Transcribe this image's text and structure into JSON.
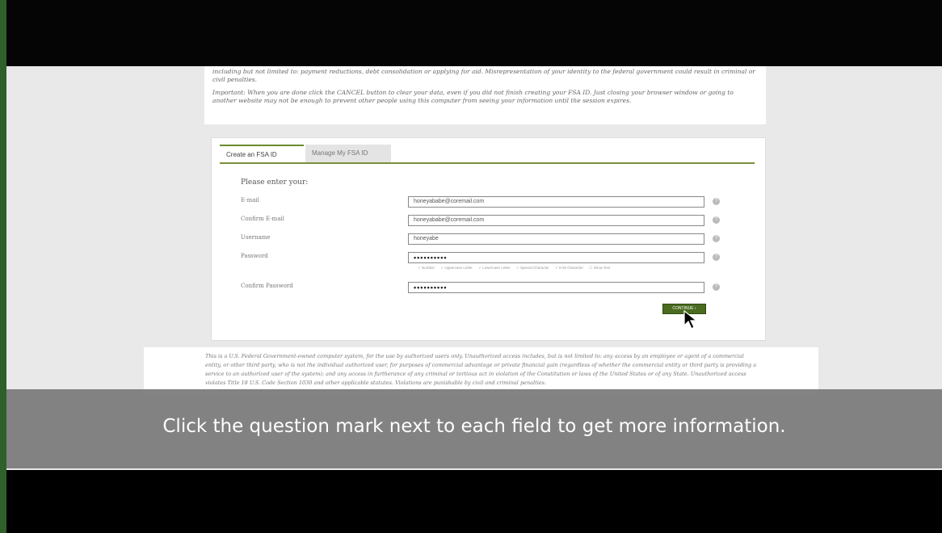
{
  "intro": {
    "paragraph1": "including but not limited to: payment reductions, debt consolidation or applying for aid. Misrepresentation of your identity to the federal government could result in criminal or civil penalties.",
    "paragraph2": "Important: When you are done click the CANCEL button to clear your data, even if you did not finish creating your FSA ID. Just closing your browser window or going to another website may not be enough to prevent other people using this computer from seeing your information until the session expires."
  },
  "tabs": [
    {
      "label": "Create an FSA ID"
    },
    {
      "label": "Manage My FSA ID"
    }
  ],
  "form": {
    "heading": "Please enter your:",
    "fields": [
      {
        "label": "E-mail",
        "value": "honeyababe@coremail.com"
      },
      {
        "label": "Confirm E-mail",
        "value": "honeyababe@coremail.com"
      },
      {
        "label": "Username",
        "value": "honeyabe"
      },
      {
        "label": "Password",
        "value": "••••••••••"
      },
      {
        "label": "Confirm Password",
        "value": "••••••••••"
      }
    ],
    "help_glyph": "?",
    "requirements": [
      "✓ Number",
      "✓ Uppercase Letter",
      "✓ Lowercase Letter",
      "✓ Special Character",
      "✓ 8-30 Character",
      "☐ Show Text"
    ],
    "continue_label": "CONTINUE ›"
  },
  "footer": {
    "text": "This is a U.S. Federal Government-owned computer system, for the use by authorized users only. Unauthorized access includes, but is not limited to: any access by an employee or agent of a commercial entity, or other third party, who is not the individual authorized user, for purposes of commercial advantage or private financial gain (regardless of whether the commercial entity or third party is providing a service to an authorized user of the system); and any access in furtherance of any criminal or tortious act in violation of the Constitution or laws of the United States or of any State. Unauthorized access violates Title 18 U.S. Code Section 1030 and other applicable statutes. Violations are punishable by civil and criminal penalties."
  },
  "caption": "Click the question mark next to each field to get more information.",
  "colors": {
    "accent": "#6b8a2e",
    "button": "#4a6b20",
    "caption_bg": "#787878"
  }
}
